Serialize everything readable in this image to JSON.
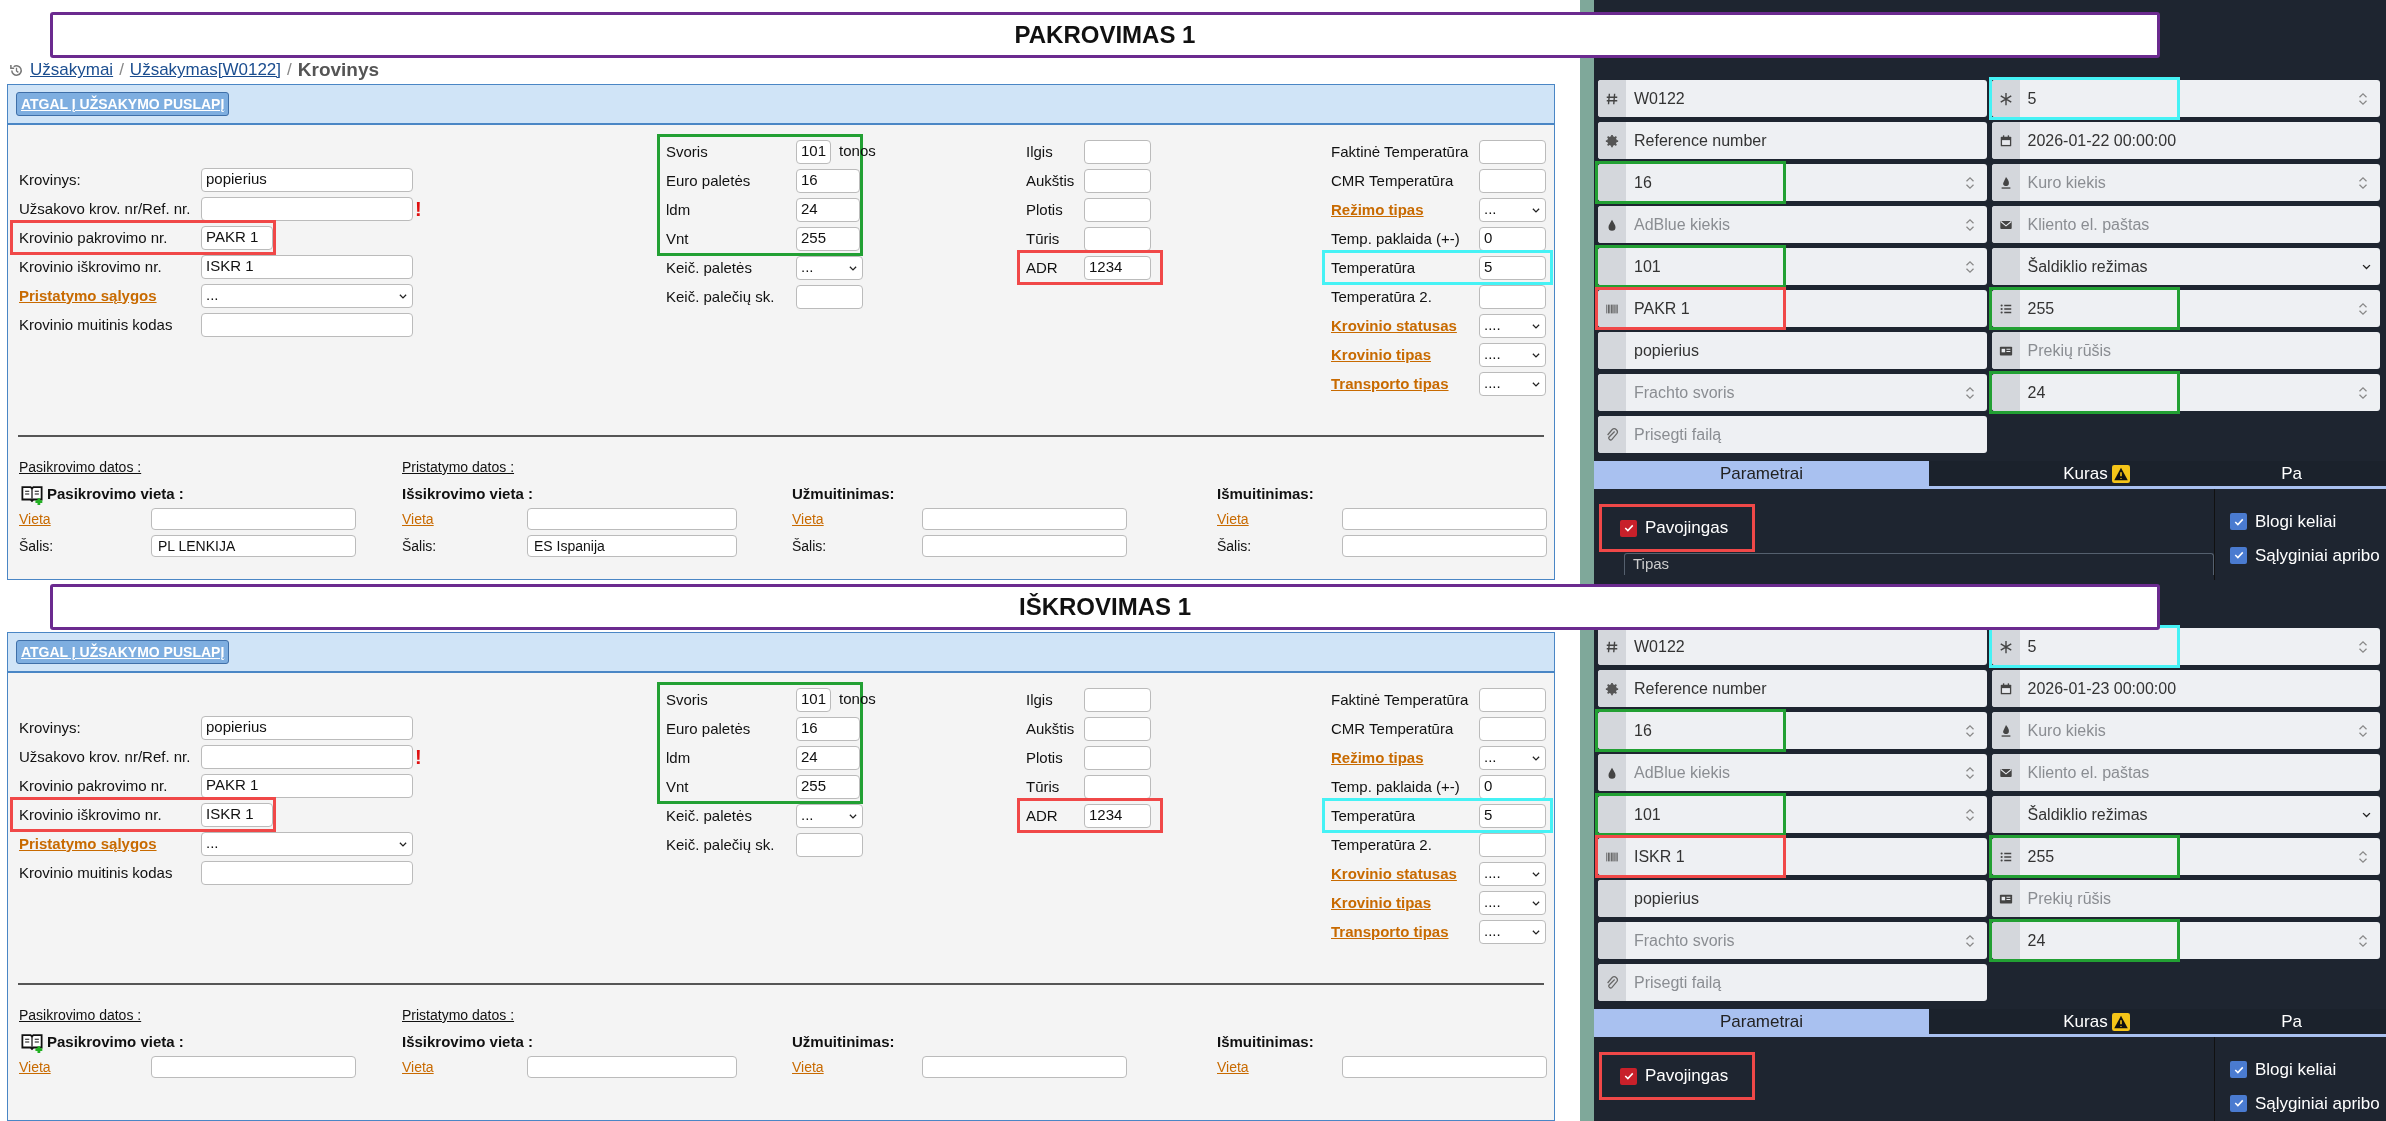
{
  "panels": [
    {
      "title": "PAKROVIMAS 1",
      "breadcrumb": [
        {
          "kind": "link",
          "text": "Užsakymai"
        },
        {
          "kind": "separator",
          "text": "/"
        },
        {
          "kind": "link",
          "text": "Užsakymas[W0122]"
        },
        {
          "kind": "separator",
          "text": "/"
        },
        {
          "kind": "current",
          "text": "Krovinys"
        }
      ],
      "back_button": "ATGAL Į UŽSAKYMO PUSLAPĮ",
      "columns": [
        [
          {
            "label": "Krovinys:",
            "kind": "input",
            "value": "popierius"
          },
          {
            "label": "Užsakovo krov. nr/Ref. nr.",
            "kind": "input",
            "mark": "!"
          },
          {
            "label": "Krovinio pakrovimo nr.",
            "kind": "input",
            "value": "PAKR 1",
            "color": "#f04848"
          },
          {
            "label": "Krovinio iškrovimo nr.",
            "kind": "input",
            "value": "ISKR 1"
          },
          {
            "label": "Pristatymo sąlygos",
            "link": true,
            "kind": "select",
            "value": "..."
          },
          {
            "label": "Krovinio muitinis kodas",
            "kind": "input"
          }
        ],
        [
          {
            "label": "Svoris",
            "kind": "input",
            "value": "101",
            "unit": "tonos",
            "color": "#22a033"
          },
          {
            "label": "Euro paletės",
            "kind": "input",
            "value": "16",
            "color": "#22a033"
          },
          {
            "label": "ldm",
            "kind": "input",
            "value": "24",
            "color": "#22a033"
          },
          {
            "label": "Vnt",
            "kind": "input",
            "value": "255",
            "color": "#22a033"
          },
          {
            "label": "Keič. paletės",
            "kind": "select",
            "value": "..."
          },
          {
            "label": "Keič. palečių sk.",
            "kind": "input"
          }
        ],
        [
          {
            "label": "Ilgis",
            "kind": "input"
          },
          {
            "label": "Aukštis",
            "kind": "input"
          },
          {
            "label": "Plotis",
            "kind": "input"
          },
          {
            "label": "Tūris",
            "kind": "input"
          },
          {
            "label": "ADR",
            "kind": "input",
            "value": "1234",
            "color": "#f04848"
          }
        ],
        [
          {
            "label": "Faktinė Temperatūra",
            "kind": "input"
          },
          {
            "label": "CMR Temperatūra",
            "kind": "input"
          },
          {
            "label": "Režimo tipas",
            "link": true,
            "kind": "select",
            "value": "..."
          },
          {
            "label": "Temp. paklaida (+-)",
            "kind": "input",
            "value": "0"
          },
          {
            "label": "Temperatūra",
            "kind": "input",
            "value": "5",
            "color": "#45f2f5"
          },
          {
            "label": "Temperatūra 2.",
            "kind": "input"
          },
          {
            "label": "Krovinio statusas",
            "link": true,
            "kind": "select",
            "value": "...."
          },
          {
            "label": "Krovinio tipas",
            "link": true,
            "kind": "select",
            "value": "...."
          },
          {
            "label": "Transporto tipas",
            "link": true,
            "kind": "select",
            "value": "...."
          }
        ]
      ],
      "date_headers": [
        "Pasikrovimo datos :",
        "Pristatymo datos :"
      ],
      "locations": [
        {
          "heading": "Pasikrovimo vieta :",
          "icon": true,
          "fields": [
            {
              "label": "Vieta",
              "link": true
            },
            {
              "label": "Šalis:",
              "value": "PL LENKIJA"
            }
          ]
        },
        {
          "heading": "Išsikrovimo vieta :",
          "fields": [
            {
              "label": "Vieta",
              "link": true
            },
            {
              "label": "Šalis:",
              "value": "ES Ispanija"
            }
          ]
        },
        {
          "heading": "Užmuitinimas:",
          "fields": [
            {
              "label": "Vieta",
              "link": true
            },
            {
              "label": "Šalis:"
            }
          ]
        },
        {
          "heading": "Išmuitinimas:",
          "fields": [
            {
              "label": "Vieta",
              "link": true
            },
            {
              "label": "Šalis:"
            }
          ]
        }
      ],
      "app_fields": [
        [
          {
            "kind": "hash",
            "value": "W0122"
          },
          {
            "kind": "snowflake",
            "value": "5",
            "spinner": true,
            "color": "#45f2f5"
          }
        ],
        [
          {
            "kind": "seal",
            "value": "Reference number"
          },
          {
            "kind": "calendar",
            "value": "2026-01-22 00:00:00"
          }
        ],
        [
          {
            "kind": "blank",
            "value": "16",
            "spinner": true,
            "color": "#22a033"
          },
          {
            "kind": "flame",
            "placeholder": "Kuro kiekis",
            "spinner": true
          }
        ],
        [
          {
            "kind": "drop",
            "placeholder": "AdBlue kiekis",
            "spinner": true
          },
          {
            "kind": "envelope",
            "placeholder": "Kliento el. paštas"
          }
        ],
        [
          {
            "kind": "blank",
            "value": "101",
            "spinner": true,
            "color": "#22a033"
          },
          {
            "kind": "blank",
            "value": "Šaldiklio režimas",
            "select": true
          }
        ],
        [
          {
            "kind": "barcode",
            "value": "PAKR 1",
            "color": "#f04848"
          },
          {
            "kind": "list",
            "value": "255",
            "spinner": true,
            "color": "#22a033"
          }
        ],
        [
          {
            "kind": "blank",
            "value": "popierius"
          },
          {
            "kind": "idcard",
            "placeholder": "Prekių rūšis"
          }
        ],
        [
          {
            "kind": "blank",
            "placeholder": "Frachto svoris",
            "spinner": true
          },
          {
            "kind": "blank",
            "value": "24",
            "spinner": true,
            "color": "#22a033"
          }
        ],
        [
          {
            "kind": "paperclip",
            "placeholder": "Prisegti failą"
          }
        ]
      ],
      "tabs": [
        {
          "label": "Parametrai",
          "selected": true
        },
        {
          "label": "Kuras",
          "selected": false,
          "warning": true
        },
        {
          "label": "Pa",
          "selected": false
        }
      ],
      "hazard": {
        "label": "Pavojingas",
        "checked": true,
        "color": "#f04848"
      },
      "type_select": {
        "value": "Tipas"
      },
      "conditions": [
        {
          "label": "Blogi keliai",
          "checked": true
        },
        {
          "label": "Sąlyginiai apribo",
          "checked": true
        }
      ]
    },
    {
      "title": "IŠKROVIMAS 1",
      "back_button": "ATGAL Į UŽSAKYMO PUSLAPĮ",
      "columns": [
        [
          {
            "label": "Krovinys:",
            "kind": "input",
            "value": "popierius"
          },
          {
            "label": "Užsakovo krov. nr/Ref. nr.",
            "kind": "input",
            "mark": "!"
          },
          {
            "label": "Krovinio pakrovimo nr.",
            "kind": "input",
            "value": "PAKR 1"
          },
          {
            "label": "Krovinio iškrovimo nr.",
            "kind": "input",
            "value": "ISKR 1",
            "color": "#f04848"
          },
          {
            "label": "Pristatymo sąlygos",
            "link": true,
            "kind": "select",
            "value": "..."
          },
          {
            "label": "Krovinio muitinis kodas",
            "kind": "input"
          }
        ],
        [
          {
            "label": "Svoris",
            "kind": "input",
            "value": "101",
            "unit": "tonos",
            "color": "#22a033"
          },
          {
            "label": "Euro paletės",
            "kind": "input",
            "value": "16",
            "color": "#22a033"
          },
          {
            "label": "ldm",
            "kind": "input",
            "value": "24",
            "color": "#22a033"
          },
          {
            "label": "Vnt",
            "kind": "input",
            "value": "255",
            "color": "#22a033"
          },
          {
            "label": "Keič. paletės",
            "kind": "select",
            "value": "..."
          },
          {
            "label": "Keič. palečių sk.",
            "kind": "input"
          }
        ],
        [
          {
            "label": "Ilgis",
            "kind": "input"
          },
          {
            "label": "Aukštis",
            "kind": "input"
          },
          {
            "label": "Plotis",
            "kind": "input"
          },
          {
            "label": "Tūris",
            "kind": "input"
          },
          {
            "label": "ADR",
            "kind": "input",
            "value": "1234",
            "color": "#f04848"
          }
        ],
        [
          {
            "label": "Faktinė Temperatūra",
            "kind": "input"
          },
          {
            "label": "CMR Temperatūra",
            "kind": "input"
          },
          {
            "label": "Režimo tipas",
            "link": true,
            "kind": "select",
            "value": "..."
          },
          {
            "label": "Temp. paklaida (+-)",
            "kind": "input",
            "value": "0"
          },
          {
            "label": "Temperatūra",
            "kind": "input",
            "value": "5",
            "color": "#45f2f5"
          },
          {
            "label": "Temperatūra 2.",
            "kind": "input"
          },
          {
            "label": "Krovinio statusas",
            "link": true,
            "kind": "select",
            "value": "...."
          },
          {
            "label": "Krovinio tipas",
            "link": true,
            "kind": "select",
            "value": "...."
          },
          {
            "label": "Transporto tipas",
            "link": true,
            "kind": "select",
            "value": "...."
          }
        ]
      ],
      "date_headers": [
        "Pasikrovimo datos :",
        "Pristatymo datos :"
      ],
      "locations": [
        {
          "heading": "Pasikrovimo vieta :",
          "icon": true,
          "fields": [
            {
              "label": "Vieta",
              "link": true
            }
          ]
        },
        {
          "heading": "Išsikrovimo vieta :",
          "fields": [
            {
              "label": "Vieta",
              "link": true
            }
          ]
        },
        {
          "heading": "Užmuitinimas:",
          "fields": [
            {
              "label": "Vieta",
              "link": true
            }
          ]
        },
        {
          "heading": "Išmuitinimas:",
          "fields": [
            {
              "label": "Vieta",
              "link": true
            }
          ]
        }
      ],
      "app_fields": [
        [
          {
            "kind": "hash",
            "value": "W0122"
          },
          {
            "kind": "snowflake",
            "value": "5",
            "spinner": true,
            "color": "#45f2f5"
          }
        ],
        [
          {
            "kind": "seal",
            "value": "Reference number"
          },
          {
            "kind": "calendar",
            "value": "2026-01-23 00:00:00"
          }
        ],
        [
          {
            "kind": "blank",
            "value": "16",
            "spinner": true,
            "color": "#22a033"
          },
          {
            "kind": "flame",
            "placeholder": "Kuro kiekis",
            "spinner": true
          }
        ],
        [
          {
            "kind": "drop",
            "placeholder": "AdBlue kiekis",
            "spinner": true
          },
          {
            "kind": "envelope",
            "placeholder": "Kliento el. paštas"
          }
        ],
        [
          {
            "kind": "blank",
            "value": "101",
            "spinner": true,
            "color": "#22a033"
          },
          {
            "kind": "blank",
            "value": "Šaldiklio režimas",
            "select": true
          }
        ],
        [
          {
            "kind": "barcode",
            "value": "ISKR 1",
            "color": "#f04848"
          },
          {
            "kind": "list",
            "value": "255",
            "spinner": true,
            "color": "#22a033"
          }
        ],
        [
          {
            "kind": "blank",
            "value": "popierius"
          },
          {
            "kind": "idcard",
            "placeholder": "Prekių rūšis"
          }
        ],
        [
          {
            "kind": "blank",
            "placeholder": "Frachto svoris",
            "spinner": true
          },
          {
            "kind": "blank",
            "value": "24",
            "spinner": true,
            "color": "#22a033"
          }
        ],
        [
          {
            "kind": "paperclip",
            "placeholder": "Prisegti failą"
          }
        ]
      ],
      "tabs": [
        {
          "label": "Parametrai",
          "selected": true
        },
        {
          "label": "Kuras",
          "selected": false,
          "warning": true
        },
        {
          "label": "Pa",
          "selected": false
        }
      ],
      "hazard": {
        "label": "Pavojingas",
        "checked": true,
        "color": "#f04848"
      },
      "conditions": [
        {
          "label": "Blogi keliai",
          "checked": true
        },
        {
          "label": "Sąlyginiai apribo",
          "checked": true
        }
      ]
    }
  ]
}
